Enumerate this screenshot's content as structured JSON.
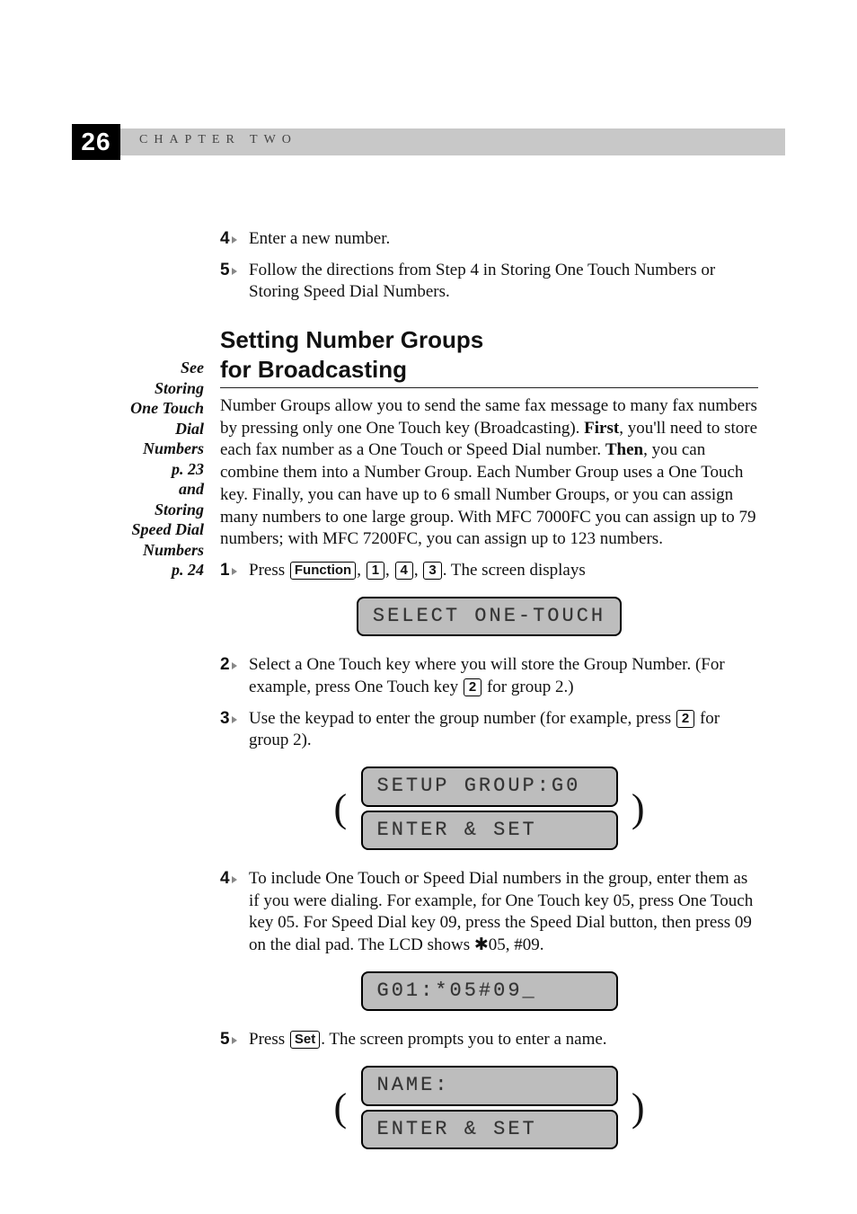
{
  "header": {
    "page_number": "26",
    "chapter_label": "CHAPTER TWO"
  },
  "prior_steps": {
    "s4": {
      "num": "4",
      "text": "Enter a new number."
    },
    "s5": {
      "num": "5",
      "text": "Follow the directions from Step 4 in Storing One Touch Numbers or Storing Speed Dial Numbers."
    }
  },
  "section": {
    "heading_line1": "Setting Number Groups",
    "heading_line2": "for Broadcasting",
    "intro_before_first": "Number Groups allow you to send the same fax message to many fax numbers by pressing only one One Touch key (Broadcasting). ",
    "first_word": "First",
    "intro_mid1": ", you'll need to store each fax number as a One Touch or Speed Dial number. ",
    "then_word": "Then",
    "intro_mid2": ", you can combine them into a Number Group. Each Number Group uses a One Touch key. Finally, you can have up to 6 small Number Groups, or you can assign many numbers to one large group. With MFC 7000FC you can assign up to 79 numbers; with MFC 7200FC, you can assign up to 123 numbers."
  },
  "sidebar": {
    "line1": "See",
    "line2": "Storing",
    "line3": "One Touch",
    "line4": "Dial",
    "line5": "Numbers",
    "line6": "p. 23",
    "line7": "and",
    "line8": "Storing",
    "line9": "Speed Dial",
    "line10": "Numbers",
    "line11": "p. 24"
  },
  "steps": {
    "s1": {
      "num": "1",
      "pre": "Press ",
      "key_fn": "Function",
      "key_1": "1",
      "key_4": "4",
      "key_3": "3",
      "post": ". The screen displays"
    },
    "lcd1": "SELECT ONE-TOUCH",
    "s2": {
      "num": "2",
      "pre": "Select a One Touch key where you will store the Group Number. (For example, press One Touch key ",
      "key_2": "2",
      "post": " for group 2.)"
    },
    "s3": {
      "num": "3",
      "pre": "Use the keypad to enter the group number (for example, press ",
      "key_2": "2",
      "post": " for group 2)."
    },
    "lcd2a": "SETUP GROUP:G0",
    "lcd2b": "ENTER & SET",
    "s4": {
      "num": "4",
      "pre": "To include One Touch or Speed Dial numbers in the group, enter them as if you were dialing. For example, for One Touch key 05, press One Touch key 05. For Speed Dial key 09, press the Speed Dial button, then press 09 on the dial pad. The LCD shows ",
      "star": "✱",
      "post": "05, #09."
    },
    "lcd3": "G01:*05#09_",
    "s5": {
      "num": "5",
      "pre": "Press ",
      "key_set": "Set",
      "post": ". The screen prompts you to enter a name."
    },
    "lcd4a": "NAME:",
    "lcd4b": "ENTER & SET"
  }
}
